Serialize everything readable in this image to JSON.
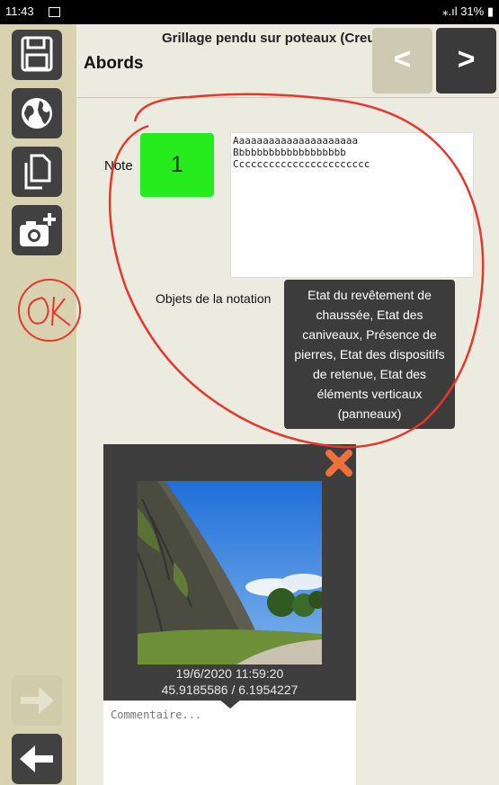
{
  "status": {
    "time": "11:43",
    "signal_battery": "31%"
  },
  "header": {
    "title": "Grillage pendu sur poteaux (Creux)",
    "section": "Abords",
    "prev_label": "<",
    "next_label": ">"
  },
  "sidebar": {
    "items": [
      {
        "icon": "save-icon"
      },
      {
        "icon": "globe-icon"
      },
      {
        "icon": "copy-icon"
      },
      {
        "icon": "add-camera-icon"
      },
      {
        "icon": "arrow-right-icon"
      },
      {
        "icon": "arrow-left-icon"
      }
    ]
  },
  "note": {
    "label": "Note",
    "value": "1",
    "text": "Aaaaaaaaaaaaaaaaaaaaa\nBbbbbbbbbbbbbbbbbbb\nCcccccccccccccccccccccc"
  },
  "objects": {
    "label": "Objets de la notation",
    "tooltip": "Etat du revêtement de chaussée, Etat des caniveaux, Présence de pierres, Etat des dispositifs de retenue, Etat des éléments verticaux (panneaux)"
  },
  "photo": {
    "date": "19/6/2020 11:59:20",
    "coords": "45.9185586 / 6.1954227",
    "comment_placeholder": "Commentaire..."
  },
  "annotation": {
    "ok": "OK"
  },
  "colors": {
    "accent_green": "#26ec1e",
    "close_orange": "#f0703c",
    "sidebar": "#d7d3b0",
    "annotation_red": "#e8362c"
  }
}
